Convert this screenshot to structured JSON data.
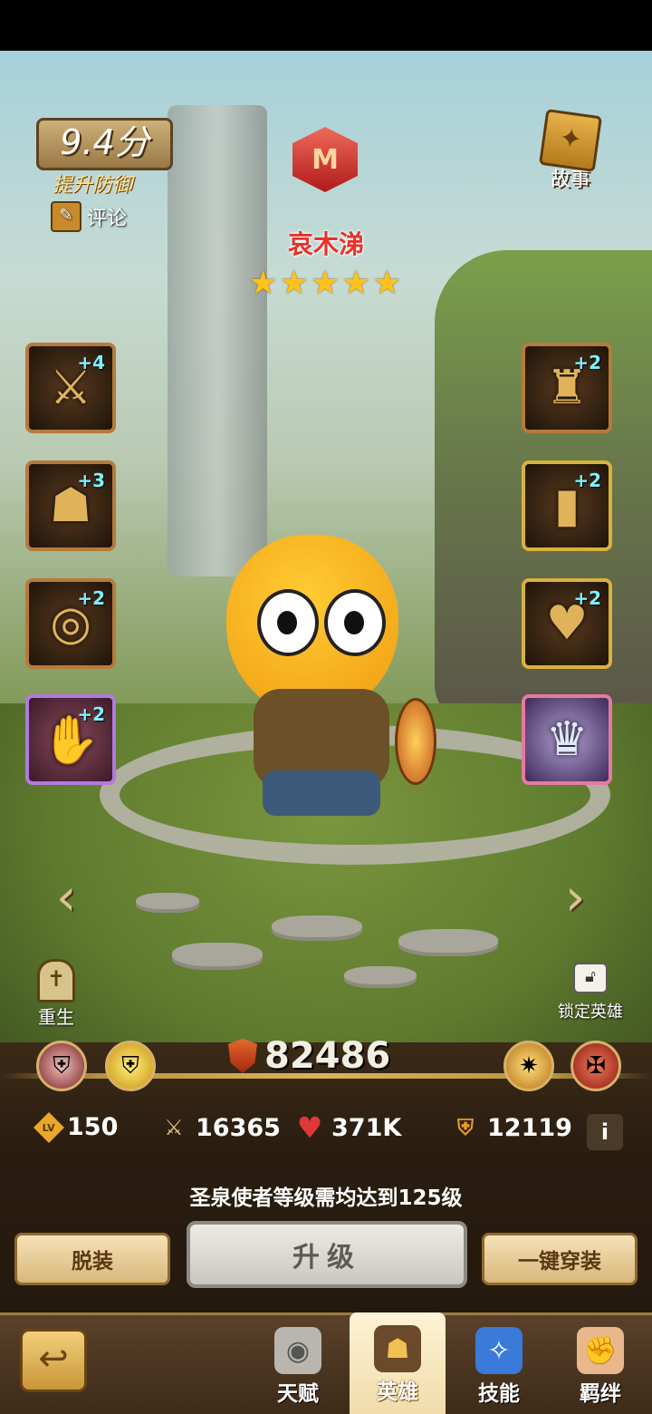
{
  "rating": {
    "score": "9.4分",
    "improve_label": "提升防御",
    "comment_label": "评论"
  },
  "story": {
    "label": "故事"
  },
  "hero": {
    "name": "哀木涕",
    "stars": "★★★★★",
    "star_count": 5
  },
  "equipment": {
    "left": [
      {
        "name": "sword",
        "plus": "+4",
        "glyph": "⚔"
      },
      {
        "name": "helmet",
        "plus": "+3",
        "glyph": "☗"
      },
      {
        "name": "ring",
        "plus": "+2",
        "glyph": "◎"
      },
      {
        "name": "gauntlet",
        "plus": "+2",
        "glyph": "✋"
      }
    ],
    "right": [
      {
        "name": "armor",
        "plus": "+2",
        "glyph": "♜"
      },
      {
        "name": "boots",
        "plus": "+2",
        "glyph": "▮"
      },
      {
        "name": "amulet",
        "plus": "+2",
        "glyph": "♥"
      },
      {
        "name": "crown",
        "plus": "",
        "glyph": "♛"
      }
    ]
  },
  "actions": {
    "rebirth": "重生",
    "lock": "锁定英雄"
  },
  "power": "82486",
  "stats": {
    "level": "150",
    "attack": "16365",
    "hp": "371K",
    "defense": "12119",
    "info": "i"
  },
  "notice": "圣泉使者等级需均达到125级",
  "buttons": {
    "unequip": "脱装",
    "upgrade": "升级",
    "equip_all": "一键穿装"
  },
  "nav": {
    "talent": "天赋",
    "hero": "英雄",
    "skill": "技能",
    "bond": "羁绊"
  },
  "icons": {
    "lv_badge": "LV"
  }
}
